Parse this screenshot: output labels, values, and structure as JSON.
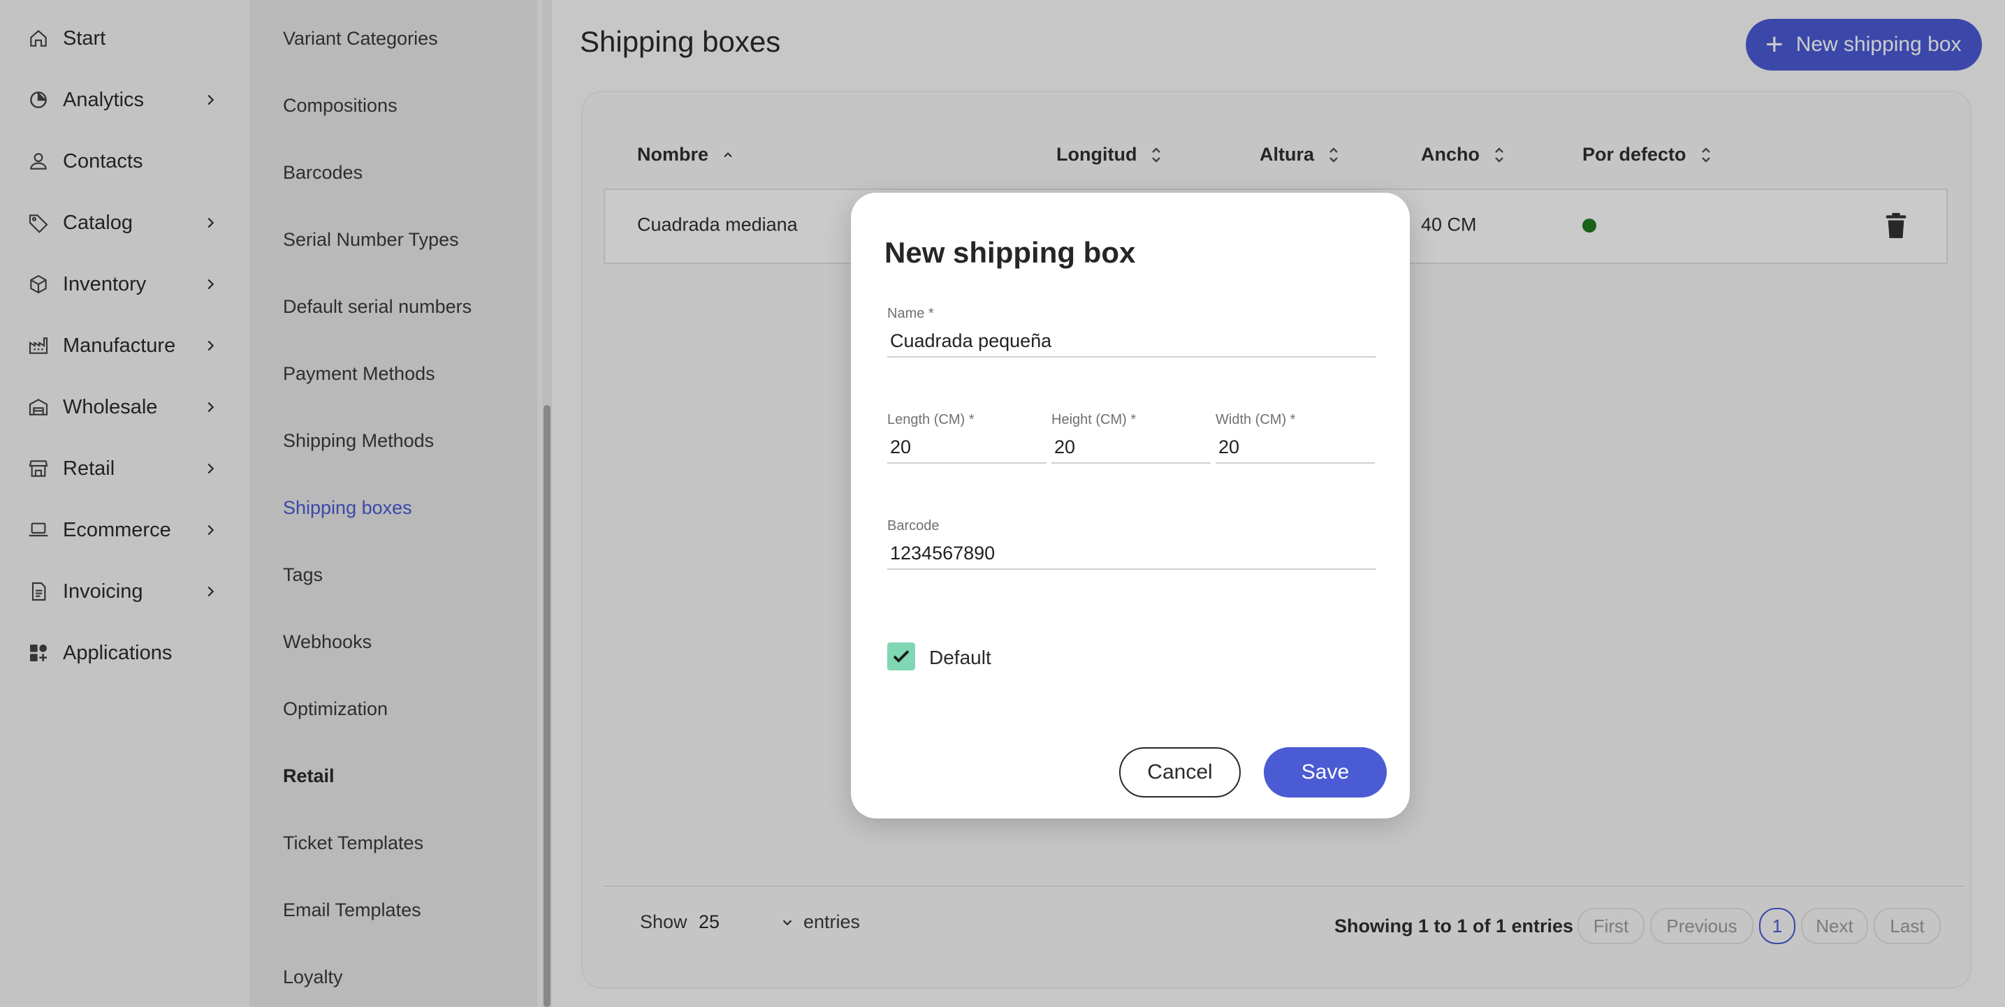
{
  "sidebar": {
    "items": [
      {
        "label": "Start",
        "icon": "home-icon",
        "has_arrow": false
      },
      {
        "label": "Analytics",
        "icon": "pie-chart-icon",
        "has_arrow": true
      },
      {
        "label": "Contacts",
        "icon": "user-icon",
        "has_arrow": false
      },
      {
        "label": "Catalog",
        "icon": "tag-icon",
        "has_arrow": true
      },
      {
        "label": "Inventory",
        "icon": "box-icon",
        "has_arrow": true
      },
      {
        "label": "Manufacture",
        "icon": "factory-icon",
        "has_arrow": true
      },
      {
        "label": "Wholesale",
        "icon": "warehouse-icon",
        "has_arrow": true
      },
      {
        "label": "Retail",
        "icon": "store-icon",
        "has_arrow": true
      },
      {
        "label": "Ecommerce",
        "icon": "laptop-icon",
        "has_arrow": true
      },
      {
        "label": "Invoicing",
        "icon": "document-icon",
        "has_arrow": true
      },
      {
        "label": "Applications",
        "icon": "apps-icon",
        "has_arrow": false
      }
    ]
  },
  "subnav": {
    "items": [
      {
        "label": "Variant Categories"
      },
      {
        "label": "Compositions"
      },
      {
        "label": "Barcodes"
      },
      {
        "label": "Serial Number Types"
      },
      {
        "label": "Default serial numbers"
      },
      {
        "label": "Payment Methods"
      },
      {
        "label": "Shipping Methods"
      },
      {
        "label": "Shipping boxes",
        "active": true
      },
      {
        "label": "Tags"
      },
      {
        "label": "Webhooks"
      },
      {
        "label": "Optimization"
      },
      {
        "label": "Retail",
        "section": true
      },
      {
        "label": "Ticket Templates"
      },
      {
        "label": "Email Templates"
      },
      {
        "label": "Loyalty"
      }
    ]
  },
  "header": {
    "title": "Shipping boxes",
    "new_button": "New shipping box"
  },
  "table": {
    "columns": [
      "Nombre",
      "Longitud",
      "Altura",
      "Ancho",
      "Por defecto"
    ],
    "rows": [
      {
        "nombre": "Cuadrada mediana",
        "ancho": "40 CM",
        "default": true
      }
    ]
  },
  "footer": {
    "show_label": "Show",
    "page_size": "25",
    "entries_label": "entries",
    "showing_text": "Showing 1 to 1 of 1 entries",
    "pagination": {
      "first": "First",
      "previous": "Previous",
      "current": "1",
      "next": "Next",
      "last": "Last"
    }
  },
  "modal": {
    "title": "New shipping box",
    "name_label": "Name *",
    "name_value": "Cuadrada pequeña",
    "length_label": "Length (CM) *",
    "length_value": "20",
    "height_label": "Height (CM) *",
    "height_value": "20",
    "width_label": "Width (CM) *",
    "width_value": "20",
    "barcode_label": "Barcode",
    "barcode_value": "1234567890",
    "default_label": "Default",
    "default_checked": true,
    "cancel_label": "Cancel",
    "save_label": "Save"
  },
  "colors": {
    "accent": "#4a5bd4",
    "checkbox": "#7fd7b4",
    "default_dot": "#217a21"
  }
}
